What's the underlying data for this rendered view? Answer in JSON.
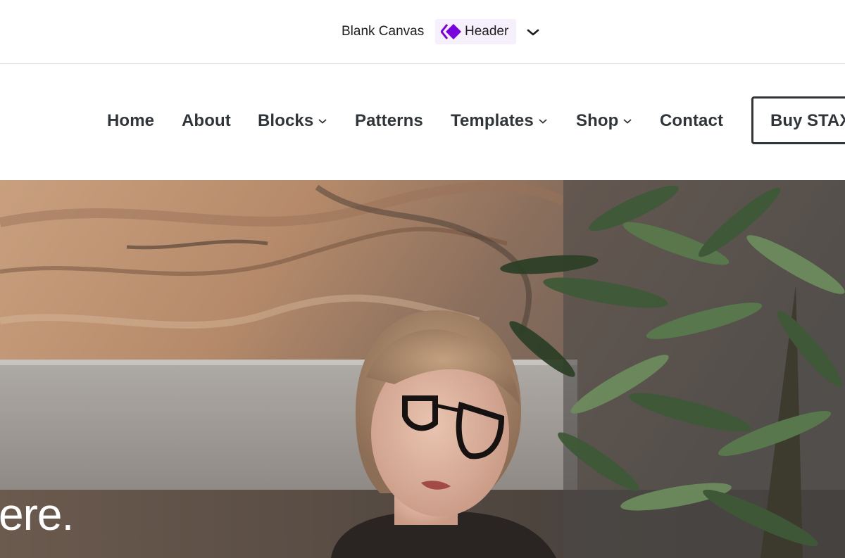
{
  "editor_bar": {
    "canvas_label": "Blank Canvas",
    "template_part_label": "Header",
    "template_part_icon": "template-part-diamond-icon",
    "accent": "#7a00df",
    "dropdown_icon": "chevron-down-icon"
  },
  "nav": {
    "items": [
      {
        "label": "Home",
        "has_submenu": false
      },
      {
        "label": "About",
        "has_submenu": false
      },
      {
        "label": "Blocks",
        "has_submenu": true
      },
      {
        "label": "Patterns",
        "has_submenu": false
      },
      {
        "label": "Templates",
        "has_submenu": true
      },
      {
        "label": "Shop",
        "has_submenu": true
      },
      {
        "label": "Contact",
        "has_submenu": false
      }
    ],
    "cta_label": "Buy STAX",
    "text_color": "#2f3539"
  },
  "hero": {
    "partial_heading": "ere."
  }
}
